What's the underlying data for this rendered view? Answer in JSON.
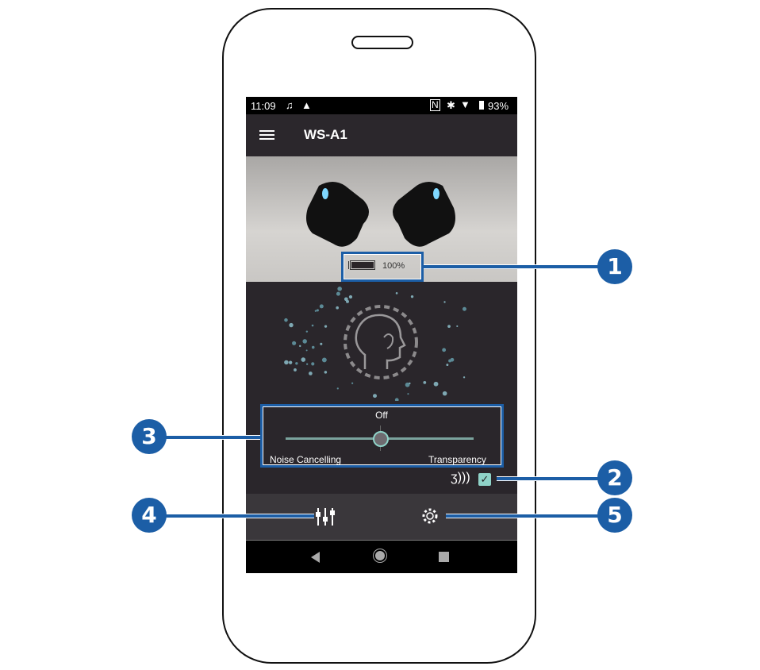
{
  "status_bar": {
    "time": "11:09",
    "battery": "93%",
    "icons": [
      "music-note-icon",
      "warning-icon",
      "nfc-icon",
      "bluetooth-icon",
      "wifi-icon",
      "battery-icon"
    ]
  },
  "app_bar": {
    "title": "WS-A1",
    "menu_icon": "hamburger-icon"
  },
  "hero": {
    "battery_level": "100%",
    "battery_fraction": 1.0
  },
  "ambient": {
    "slider_top_label": "Off",
    "left_label": "Noise Cancelling",
    "right_label": "Transparency",
    "slider_value": "Off",
    "voice_checkbox_checked": true
  },
  "bottom_bar": {
    "items": [
      "equalizer-icon",
      "settings-icon"
    ]
  },
  "callouts": [
    "1",
    "2",
    "3",
    "4",
    "5"
  ],
  "colors": {
    "callout": "#1c5ea6",
    "accent": "#8fd3c8",
    "background": "#2a262b"
  }
}
